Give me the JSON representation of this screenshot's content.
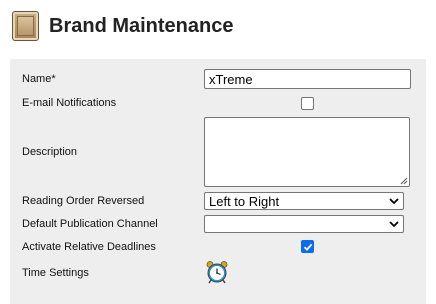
{
  "header": {
    "title": "Brand Maintenance",
    "icon": "brand-box-icon"
  },
  "form": {
    "name_label": "Name*",
    "name_value": "xTreme",
    "email_label": "E-mail Notifications",
    "email_checked": false,
    "description_label": "Description",
    "description_value": "",
    "reading_order_label": "Reading Order Reversed",
    "reading_order_value": "Left to Right",
    "publication_channel_label": "Default Publication Channel",
    "publication_channel_value": "",
    "relative_deadlines_label": "Activate Relative Deadlines",
    "relative_deadlines_checked": true,
    "time_settings_label": "Time Settings",
    "time_settings_icon": "alarm-clock-icon"
  },
  "colors": {
    "panel_bg": "#eeeeee",
    "checkbox_accent": "#0a6cf2"
  }
}
